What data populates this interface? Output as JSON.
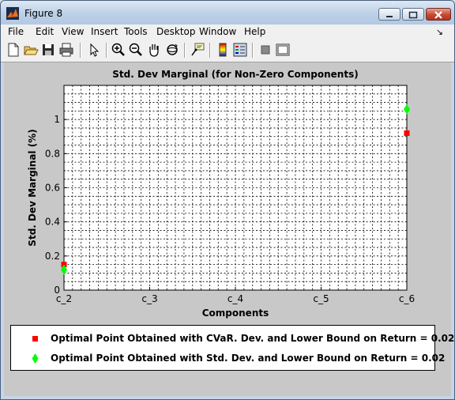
{
  "window": {
    "title": "Figure 8",
    "menu": [
      "File",
      "Edit",
      "View",
      "Insert",
      "Tools",
      "Desktop",
      "Window",
      "Help"
    ]
  },
  "toolbar": {
    "icons": [
      "new-figure-icon",
      "open-file-icon",
      "save-icon",
      "print-icon",
      "edit-plot-arrow-icon",
      "zoom-in-icon",
      "zoom-out-icon",
      "pan-hand-icon",
      "rotate-3d-icon",
      "data-cursor-icon",
      "insert-colorbar-icon",
      "insert-legend-icon",
      "hide-plot-tools-icon",
      "show-plot-tools-icon"
    ]
  },
  "chart_data": {
    "type": "scatter",
    "title": "Std. Dev Marginal (for Non-Zero Components)",
    "xlabel": "Components",
    "ylabel": "Std. Dev Marginal (%)",
    "x_tick_labels": [
      "c_2",
      "c_3",
      "c_4",
      "c_5",
      "c_6"
    ],
    "xlim": [
      2,
      6
    ],
    "ylim": [
      0,
      1.2
    ],
    "y_ticks": [
      0,
      0.2,
      0.4,
      0.6,
      0.8,
      1
    ],
    "y_tick_labels": [
      "0",
      "0.2",
      "0.4",
      "0.6",
      "0.8",
      "1"
    ],
    "grid": true,
    "series": [
      {
        "name": "Optimal Point Obtained with CVaR. Dev. and Lower Bound on Return = 0.02",
        "marker": "square",
        "color": "#ff0000",
        "points": [
          {
            "x": 2,
            "y": 0.15
          },
          {
            "x": 6,
            "y": 0.92
          }
        ]
      },
      {
        "name": "Optimal Point Obtained with Std. Dev. and Lower Bound on Return = 0.02",
        "marker": "diamond",
        "color": "#00ff00",
        "points": [
          {
            "x": 2,
            "y": 0.12
          },
          {
            "x": 6,
            "y": 1.06
          }
        ]
      }
    ]
  }
}
